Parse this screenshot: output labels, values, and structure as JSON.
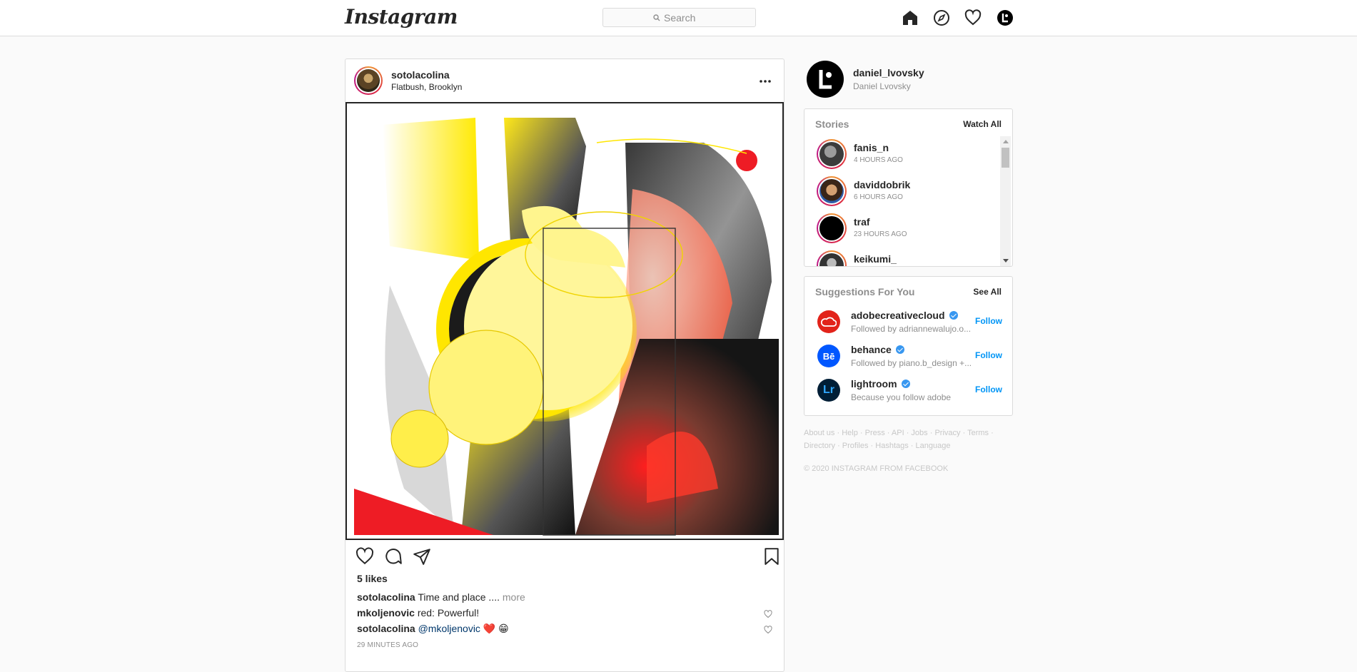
{
  "header": {
    "logo": "Instagram",
    "search_placeholder": "Search",
    "icons": [
      "home-icon",
      "explore-icon",
      "activity-heart-icon",
      "profile-avatar-icon"
    ]
  },
  "post": {
    "username": "sotolacolina",
    "location": "Flatbush, Brooklyn",
    "likes": "5 likes",
    "caption": {
      "user": "sotolacolina",
      "text": "Time and place ....",
      "more": "more"
    },
    "comments": [
      {
        "user": "mkoljenovic",
        "text": "red: Powerful!"
      },
      {
        "user": "sotolacolina",
        "mention": "@mkoljenovic",
        "emoji": "❤️ 😁"
      }
    ],
    "time": "29 MINUTES AGO"
  },
  "me": {
    "username": "daniel_lvovsky",
    "name": "Daniel Lvovsky"
  },
  "stories": {
    "title": "Stories",
    "action": "Watch All",
    "items": [
      {
        "user": "fanis_n",
        "time": "4 HOURS AGO"
      },
      {
        "user": "daviddobrik",
        "time": "6 HOURS AGO"
      },
      {
        "user": "traf",
        "time": "23 HOURS AGO"
      },
      {
        "user": "keikumi_",
        "time": ""
      }
    ]
  },
  "suggestions": {
    "title": "Suggestions For You",
    "action": "See All",
    "follow_label": "Follow",
    "items": [
      {
        "user": "adobecreativecloud",
        "sub": "Followed by adriannewalujo.o...",
        "color": "#e2231a"
      },
      {
        "user": "behance",
        "sub": "Followed by piano.b_design +...",
        "color": "#0057ff",
        "badge_text": "Bē"
      },
      {
        "user": "lightroom",
        "sub": "Because you follow adobe",
        "color": "#001e36",
        "badge_text": "Lr"
      }
    ]
  },
  "footer": {
    "links": [
      "About us",
      "Help",
      "Press",
      "API",
      "Jobs",
      "Privacy",
      "Terms",
      "Directory",
      "Profiles",
      "Hashtags",
      "Language"
    ],
    "copyright": "© 2020 INSTAGRAM FROM FACEBOOK"
  }
}
